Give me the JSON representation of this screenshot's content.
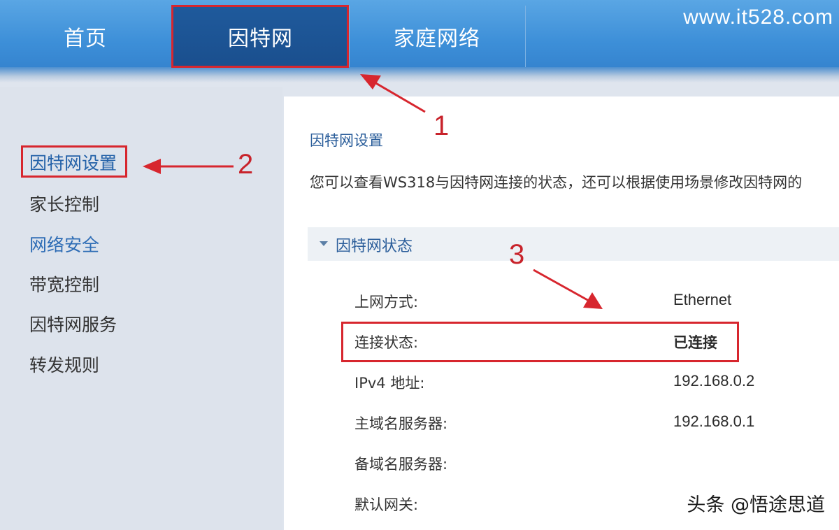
{
  "nav": {
    "tabs": [
      {
        "label": "首页"
      },
      {
        "label": "因特网"
      },
      {
        "label": "家庭网络"
      }
    ],
    "brand": "www.it528.com"
  },
  "sidebar": {
    "items": [
      {
        "label": "因特网设置"
      },
      {
        "label": "家长控制"
      },
      {
        "label": "网络安全"
      },
      {
        "label": "带宽控制"
      },
      {
        "label": "因特网服务"
      },
      {
        "label": "转发规则"
      }
    ]
  },
  "main": {
    "section_title": "因特网设置",
    "description": "您可以查看WS318与因特网连接的状态，还可以根据使用场景修改因特网的",
    "status_panel_title": "因特网状态",
    "rows": [
      {
        "label": "上网方式:",
        "value": "Ethernet"
      },
      {
        "label": "连接状态:",
        "value": "已连接"
      },
      {
        "label": "IPv4 地址:",
        "value": "192.168.0.2"
      },
      {
        "label": "主域名服务器:",
        "value": "192.168.0.1"
      },
      {
        "label": "备域名服务器:",
        "value": ""
      },
      {
        "label": "默认网关:",
        "value": ""
      }
    ]
  },
  "annotations": {
    "numbers": [
      "1",
      "2",
      "3"
    ],
    "highlight_color": "#d7262e"
  },
  "watermark": "头条 @悟途思道",
  "colors": {
    "nav_blue": "#3d8fd8",
    "nav_active": "#1f5a9c",
    "link_blue": "#2d6cb5"
  }
}
